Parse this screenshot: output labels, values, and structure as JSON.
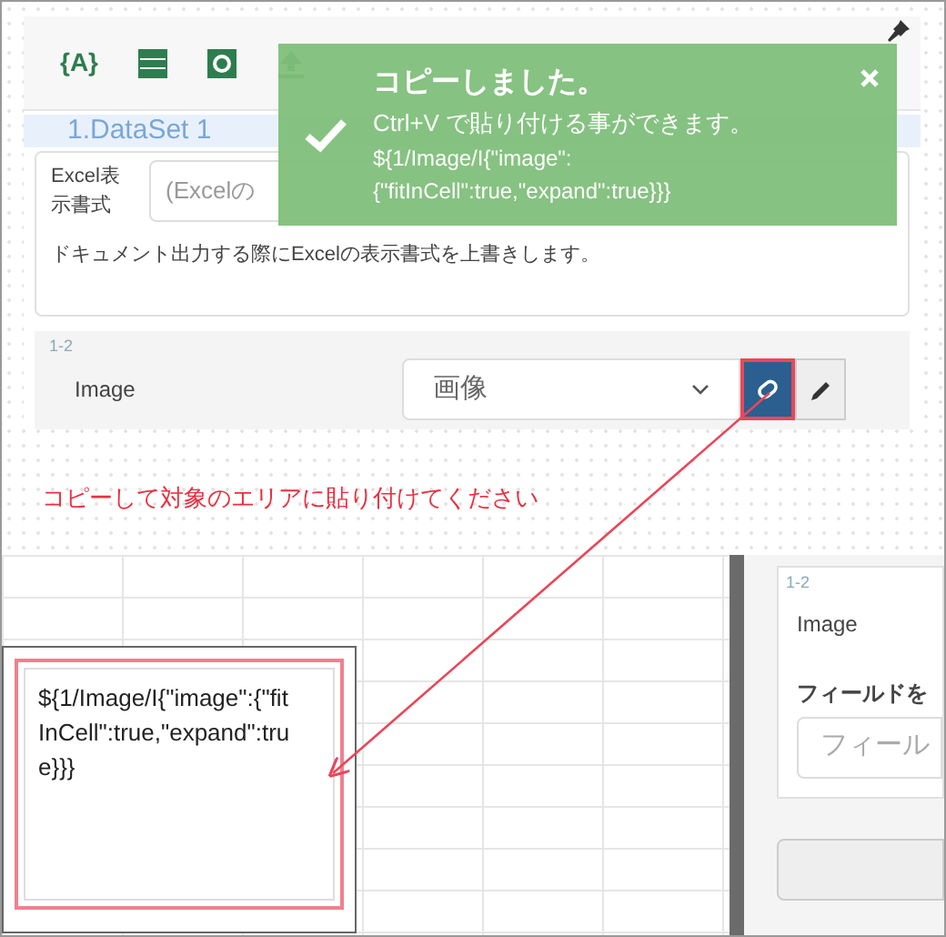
{
  "toolbar": {
    "variable_button": {
      "label": "{A}"
    }
  },
  "toast": {
    "title": "コピーしました。",
    "message": "Ctrl+V で貼り付ける事ができます。",
    "code_lines": [
      "${1/Image/I{\"image\":",
      "{\"fitInCell\":true,\"expand\":true}}}"
    ]
  },
  "dataset": {
    "label": "1.DataSet 1"
  },
  "format_card": {
    "label": "Excel表示書式",
    "value": "(Excelの",
    "description": "ドキュメント出力する際にExcelの表示書式を上書きします。"
  },
  "field_row": {
    "number": "1-2",
    "label": "Image",
    "select_value": "画像"
  },
  "annotation": "コピーして対象のエリアに貼り付けてください",
  "cell_editor": {
    "text": "${1/Image/I{\"image\":{\"fitInCell\":true,\"expand\":true}}}"
  },
  "right_panel": {
    "number": "1-2",
    "label": "Image",
    "heading": "フィールドを",
    "placeholder": "フィール"
  }
}
